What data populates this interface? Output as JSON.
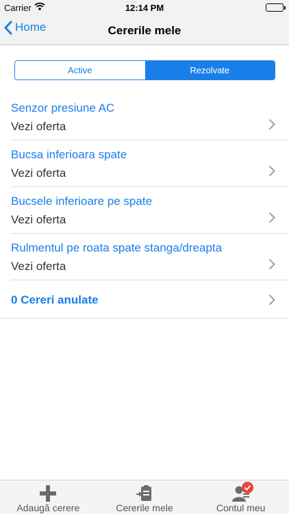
{
  "status": {
    "carrier": "Carrier",
    "time": "12:14 PM",
    "battery_level": 1.0
  },
  "nav": {
    "back_label": "Home",
    "title": "Cererile mele"
  },
  "segments": [
    {
      "label": "Active",
      "selected": false
    },
    {
      "label": "Rezolvate",
      "selected": true
    }
  ],
  "requests": [
    {
      "title": "Senzor presiune AC",
      "subtitle": "Vezi oferta"
    },
    {
      "title": "Bucsa inferioara spate",
      "subtitle": "Vezi oferta"
    },
    {
      "title": "Bucsele inferioare pe spate",
      "subtitle": "Vezi oferta"
    },
    {
      "title": "Rulmentul pe roata spate stanga/dreapta",
      "subtitle": "Vezi oferta"
    }
  ],
  "cancelled": {
    "label": "0 Cereri anulate"
  },
  "tabbar": [
    {
      "label": "Adaugă cerere",
      "icon": "plus-icon"
    },
    {
      "label": "Cererile mele",
      "icon": "clipboard-icon"
    },
    {
      "label": "Contul meu",
      "icon": "account-icon"
    }
  ],
  "colors": {
    "accent": "#1a7ee8",
    "badge": "#e8453c"
  }
}
